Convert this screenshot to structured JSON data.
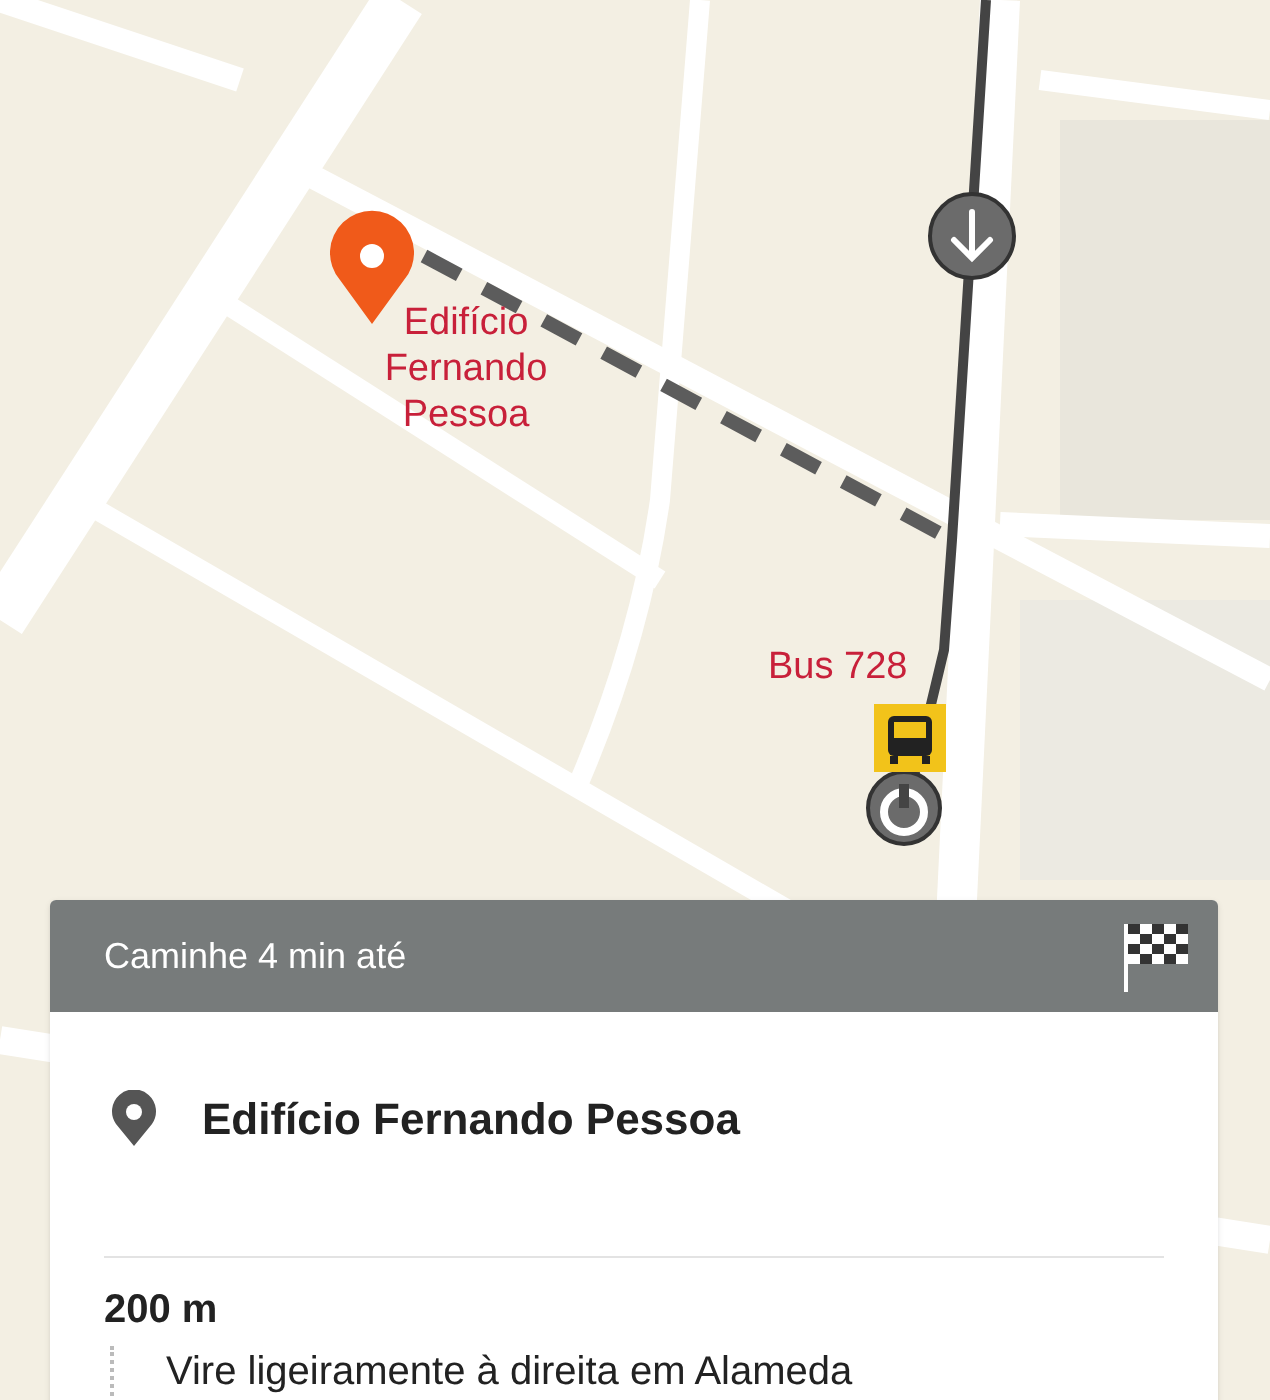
{
  "map": {
    "destination_label": "Edifício Fernando Pessoa",
    "bus_label": "Bus 728"
  },
  "panel": {
    "title": "Caminhe 4 min até",
    "destination": "Edifício Fernando Pessoa",
    "steps": [
      {
        "distance": "200 m",
        "instruction": "Vire ligeiramente à direita em Alameda"
      }
    ]
  }
}
